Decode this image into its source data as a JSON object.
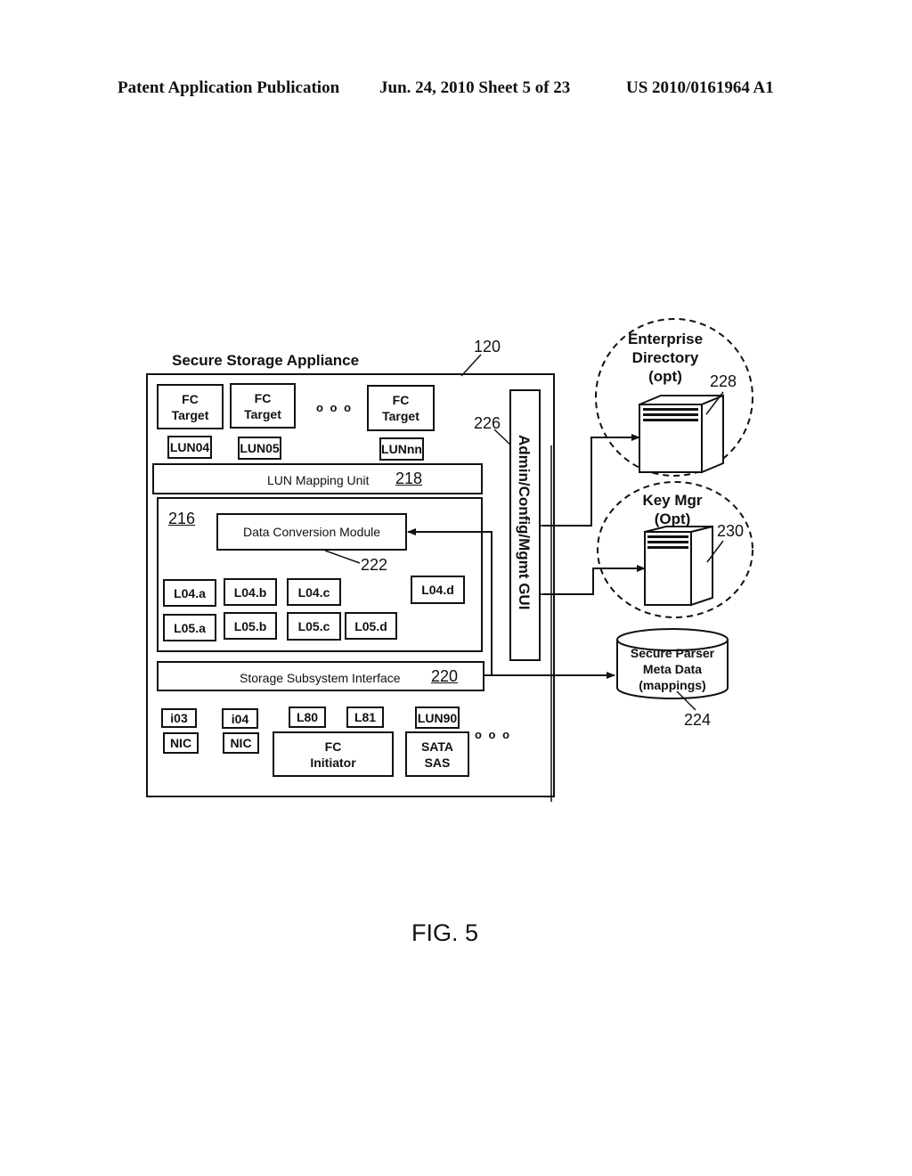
{
  "header": {
    "publication": "Patent Application Publication",
    "date_sheet": "Jun. 24, 2010  Sheet 5 of 23",
    "number": "US 2010/0161964 A1"
  },
  "appliance": {
    "title": "Secure Storage Appliance",
    "ref": "120",
    "fc_targets": [
      {
        "line1": "FC",
        "line2": "Target",
        "lun": "LUN04"
      },
      {
        "line1": "FC",
        "line2": "Target",
        "lun": "LUN05"
      },
      {
        "line1": "FC",
        "line2": "Target",
        "lun": "LUNnn"
      }
    ],
    "ellipsis": "o o o",
    "lun_mapping": {
      "label": "LUN Mapping Unit",
      "ref": "218"
    },
    "module_group": {
      "ref": "216",
      "data_conversion": {
        "label": "Data Conversion Module",
        "ref": "222"
      },
      "row1": [
        "L04.a",
        "L04.b",
        "L04.c",
        "L04.d"
      ],
      "row2": [
        "L05.a",
        "L05.b",
        "L05.c",
        "L05.d"
      ]
    },
    "storage_interface": {
      "label": "Storage Subsystem Interface",
      "ref": "220"
    },
    "bottom": {
      "nic1": {
        "port": "i03",
        "label": "NIC"
      },
      "nic2": {
        "port": "i04",
        "label": "NIC"
      },
      "fc_initiator": {
        "ports": [
          "L80",
          "L81"
        ],
        "line1": "FC",
        "line2": "Initiator"
      },
      "sata": {
        "port": "LUN90",
        "line1": "SATA",
        "line2": "SAS"
      },
      "ellipsis": "o o o"
    },
    "admin_gui": {
      "label": "Admin/Config/Mgmt GUI",
      "ref": "226"
    }
  },
  "external": {
    "enterprise_directory": {
      "line1": "Enterprise",
      "line2": "Directory",
      "line3": "(opt)",
      "ref": "228"
    },
    "key_mgr": {
      "line1": "Key Mgr",
      "line2": "(Opt)",
      "ref": "230"
    },
    "metadata": {
      "line1": "Secure Parser",
      "line2": "Meta Data",
      "line3": "(mappings)",
      "ref": "224"
    }
  },
  "figure_label": "FIG. 5"
}
